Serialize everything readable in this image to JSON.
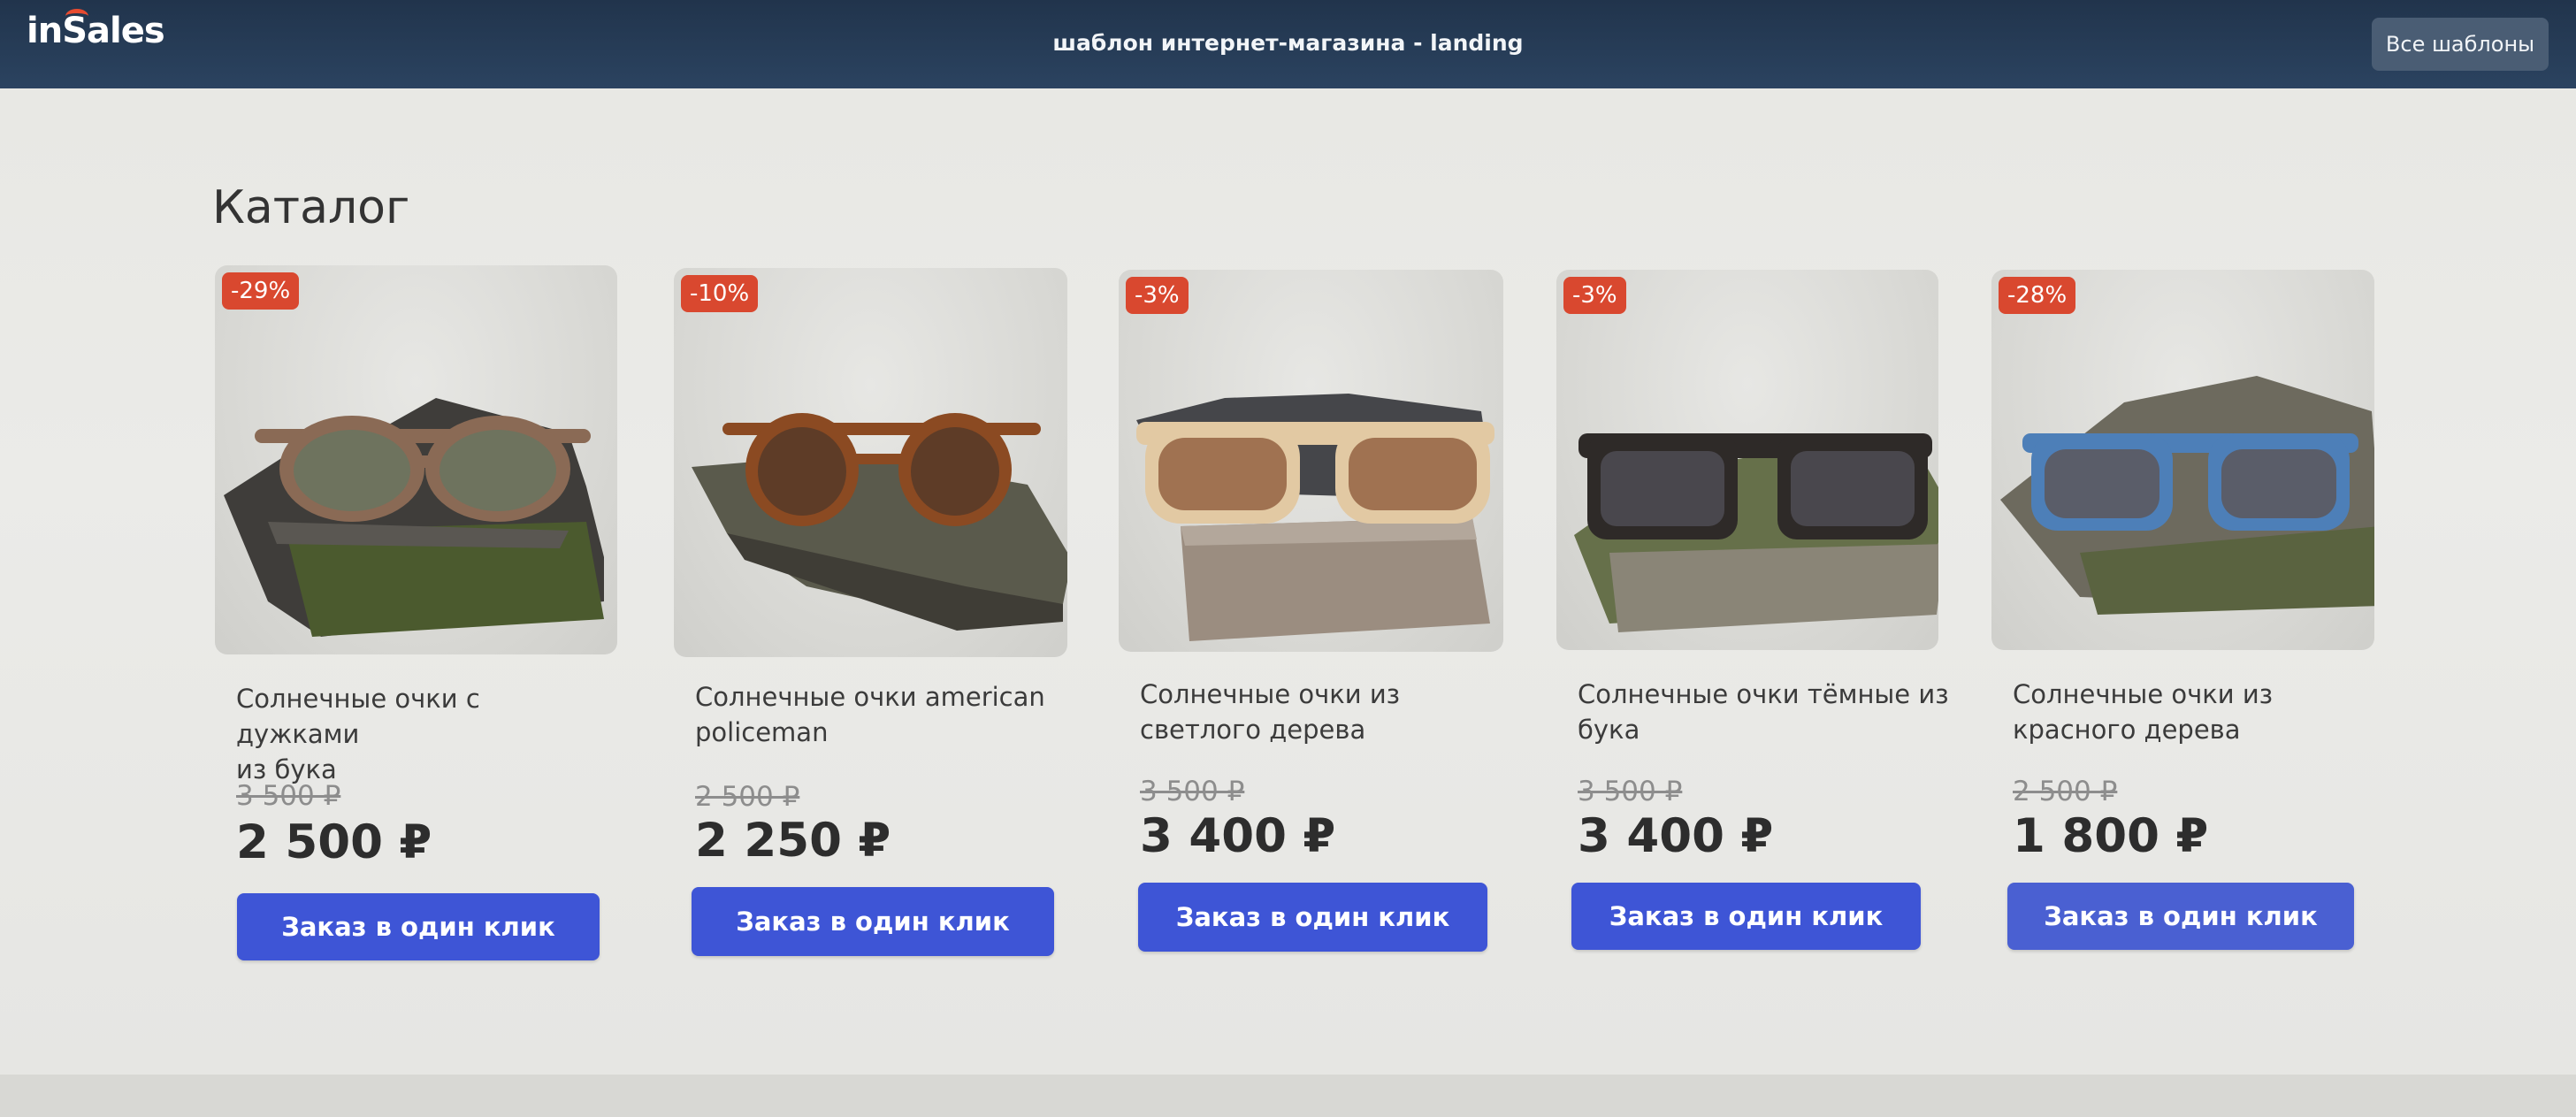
{
  "header": {
    "logo": "inSales",
    "title": "шаблон интернет-магазина - landing",
    "all_templates_label": "Все шаблоны"
  },
  "catalog": {
    "title": "Каталог",
    "products": [
      {
        "badge": "-29%",
        "name_line1": "Солнечные очки с дужками",
        "name_line2": "из бука",
        "old_price": "3 500 ₽",
        "price": "2 500 ₽",
        "button": "Заказ в один клик",
        "frame_color": "#8a6a55",
        "lens_color": "#6b7460",
        "image": "brown-round-sunglasses-on-stone"
      },
      {
        "badge": "-10%",
        "name_line1": "Солнечные очки american",
        "name_line2": "policeman",
        "old_price": "2 500 ₽",
        "price": "2 250 ₽",
        "button": "Заказ в один клик",
        "frame_color": "#8b4a22",
        "lens_color": "#5a3b28",
        "image": "tortoise-round-sunglasses-on-stone"
      },
      {
        "badge": "-3%",
        "name_line1": "Солнечные очки из",
        "name_line2": "светлого дерева",
        "old_price": "3 500 ₽",
        "price": "3 400 ₽",
        "button": "Заказ в один клик",
        "frame_color": "#e2c9a3",
        "lens_color": "#9a6a4a",
        "image": "light-wood-sunglasses-on-stone"
      },
      {
        "badge": "-3%",
        "name_line1": "Солнечные очки тёмные из",
        "name_line2": "бука",
        "old_price": "3 500 ₽",
        "price": "3 400 ₽",
        "button": "Заказ в один клик",
        "frame_color": "#2e2a28",
        "lens_color": "#4c4a50",
        "image": "dark-sunglasses-on-mossy-stone"
      },
      {
        "badge": "-28%",
        "name_line1": "Солнечные очки из",
        "name_line2": "красного дерева",
        "old_price": "2 500 ₽",
        "price": "1 800 ₽",
        "button": "Заказ в один клик",
        "frame_color": "#4d7fb8",
        "lens_color": "#5b5a62",
        "image": "blue-sunglasses-on-stone"
      }
    ]
  },
  "colors": {
    "accent": "#3e55d6",
    "badge": "#d9482f",
    "header": "#21344c"
  }
}
